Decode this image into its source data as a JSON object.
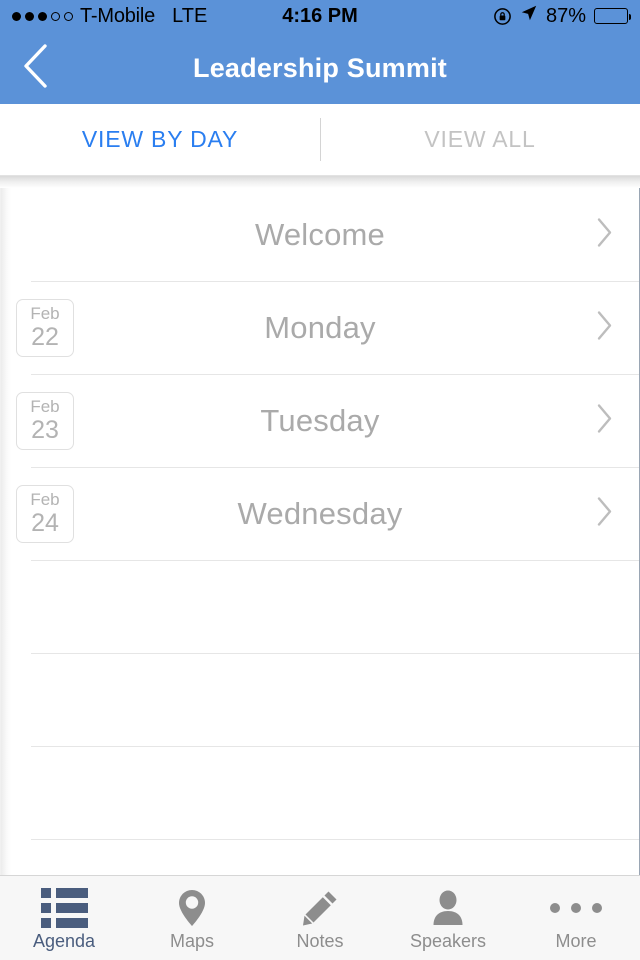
{
  "status_bar": {
    "signal_dots_filled": 3,
    "signal_dots_total": 5,
    "carrier": "T-Mobile",
    "network": "LTE",
    "time": "4:16 PM",
    "battery_percent": "87%",
    "rotation_lock_icon": "rotation-lock-icon",
    "location_icon": "location-arrow-icon",
    "battery_icon": "battery-icon"
  },
  "nav": {
    "back_icon": "back-chevron-icon",
    "title": "Leadership Summit"
  },
  "segmented_control": {
    "tabs": [
      {
        "label": "VIEW BY DAY",
        "active": true
      },
      {
        "label": "VIEW ALL",
        "active": false
      }
    ]
  },
  "agenda_list": {
    "rows": [
      {
        "title": "Welcome",
        "month": "",
        "day": "",
        "has_badge": false,
        "chevron": "chevron-right-icon"
      },
      {
        "title": "Monday",
        "month": "Feb",
        "day": "22",
        "has_badge": true,
        "chevron": "chevron-right-icon"
      },
      {
        "title": "Tuesday",
        "month": "Feb",
        "day": "23",
        "has_badge": true,
        "chevron": "chevron-right-icon"
      },
      {
        "title": "Wednesday",
        "month": "Feb",
        "day": "24",
        "has_badge": true,
        "chevron": "chevron-right-icon"
      }
    ],
    "empty_row_count": 4
  },
  "tab_bar": {
    "items": [
      {
        "label": "Agenda",
        "icon": "list-icon",
        "active": true
      },
      {
        "label": "Maps",
        "icon": "map-pin-icon",
        "active": false
      },
      {
        "label": "Notes",
        "icon": "pencil-icon",
        "active": false
      },
      {
        "label": "Speakers",
        "icon": "person-icon",
        "active": false
      },
      {
        "label": "More",
        "icon": "ellipsis-icon",
        "active": false
      }
    ]
  },
  "colors": {
    "accent_blue": "#5b92d8",
    "active_tab_text": "#2a7ef0",
    "inactive_gray": "#c3c3c3",
    "tab_active": "#4a5d7e",
    "tab_inactive": "#8d8d8d"
  }
}
